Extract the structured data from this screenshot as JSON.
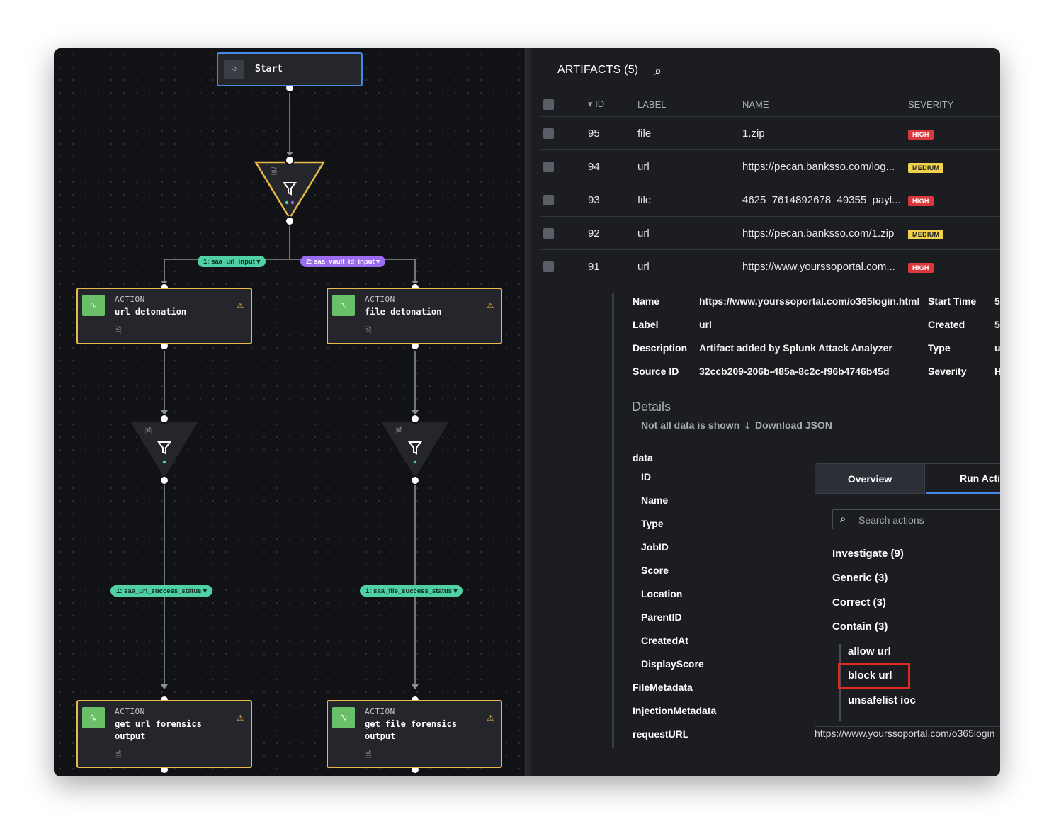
{
  "canvas": {
    "start_label": "Start",
    "pills": {
      "url_input": "1: saa_url_input",
      "vault_input": "2: saa_vault_id_input",
      "url_success": "1: saa_url_success_status",
      "file_success": "1: saa_file_success_status"
    },
    "actions": [
      {
        "kind": "ACTION",
        "title": "url detonation"
      },
      {
        "kind": "ACTION",
        "title": "file detonation"
      },
      {
        "kind": "ACTION",
        "title": "get url forensics output"
      },
      {
        "kind": "ACTION",
        "title": "get file forensics output"
      }
    ],
    "colors": {
      "start_border": "#4a86e8",
      "action_border": "#e8b84a",
      "green_pill": "#4fd1a5",
      "purple_pill": "#9b6cf0"
    }
  },
  "artifacts": {
    "title": "ARTIFACTS (5)",
    "columns": {
      "id": "▾ ID",
      "label": "LABEL",
      "name": "NAME",
      "severity": "SEVERITY"
    },
    "rows": [
      {
        "id": "95",
        "label": "file",
        "name": "1.zip",
        "severity": "HIGH"
      },
      {
        "id": "94",
        "label": "url",
        "name": "https://pecan.banksso.com/log...",
        "severity": "MEDIUM"
      },
      {
        "id": "93",
        "label": "file",
        "name": "4625_7614892678_49355_payl...",
        "severity": "HIGH"
      },
      {
        "id": "92",
        "label": "url",
        "name": "https://pecan.banksso.com/1.zip",
        "severity": "MEDIUM"
      },
      {
        "id": "91",
        "label": "url",
        "name": "https://www.yourssoportal.com...",
        "severity": "HIGH"
      }
    ]
  },
  "detail": {
    "name_key": "Name",
    "name_val": "https://www.yourssoportal.com/o365login.html",
    "label_key": "Label",
    "label_val": "url",
    "desc_key": "Description",
    "desc_val": "Artifact added by Splunk Attack Analyzer",
    "source_key": "Source ID",
    "source_val": "32ccb209-206b-485a-8c2c-f96b4746b45d",
    "start_key": "Start Time",
    "start_val": "5",
    "created_key": "Created",
    "created_val": "5",
    "type_key": "Type",
    "type_val": "u",
    "severity_key": "Severity",
    "severity_val": "H",
    "details_heading": "Details",
    "not_all": "Not all data is shown",
    "download": "Download JSON",
    "fields": [
      "data",
      "ID",
      "Name",
      "Type",
      "JobID",
      "Score",
      "Location",
      "ParentID",
      "CreatedAt",
      "DisplayScore",
      "FileMetadata",
      "InjectionMetadata",
      "requestURL"
    ],
    "request_url_val": "https://www.yourssoportal.com/o365login"
  },
  "popup": {
    "tab_overview": "Overview",
    "tab_run": "Run Acti",
    "search_placeholder": "Search actions",
    "categories": [
      "Investigate (9)",
      "Generic (3)",
      "Correct (3)",
      "Contain (3)"
    ],
    "contain_actions": [
      "allow url",
      "block url",
      "unsafelist ioc"
    ],
    "highlight_color": "#e0281e"
  }
}
